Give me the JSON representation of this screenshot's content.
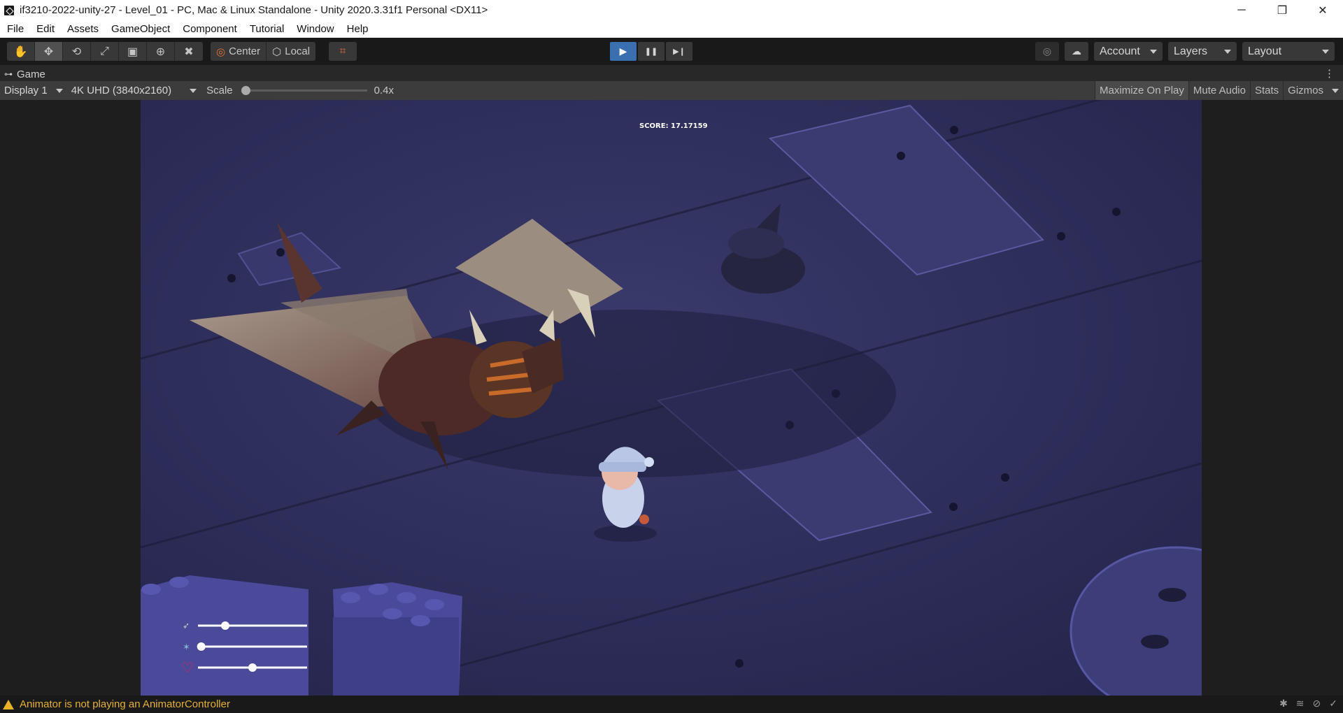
{
  "window": {
    "title": "if3210-2022-unity-27 - Level_01 - PC, Mac & Linux Standalone - Unity 2020.3.31f1 Personal <DX11>",
    "minimize_glyph": "─",
    "restore_glyph": "❐",
    "close_glyph": "✕"
  },
  "menu": [
    "File",
    "Edit",
    "Assets",
    "GameObject",
    "Component",
    "Tutorial",
    "Window",
    "Help"
  ],
  "toolbar": {
    "tools": [
      {
        "name": "hand-tool",
        "glyph": "✋",
        "active": false
      },
      {
        "name": "move-tool",
        "glyph": "✥",
        "active": true
      },
      {
        "name": "rotate-tool",
        "glyph": "⟲",
        "active": false
      },
      {
        "name": "scale-tool",
        "glyph": "⤢",
        "active": false
      },
      {
        "name": "rect-tool",
        "glyph": "▣",
        "active": false
      },
      {
        "name": "transform-tool",
        "glyph": "⊕",
        "active": false
      },
      {
        "name": "custom-tool",
        "glyph": "✖",
        "active": false
      }
    ],
    "pivot_label": "Center",
    "space_label": "Local",
    "grid_glyph": "⌗",
    "play_glyph": "▶",
    "pause_glyph": "❚❚",
    "step_glyph": "▶❙",
    "collab_glyph": "◎",
    "cloud_glyph": "☁",
    "account_label": "Account",
    "layers_label": "Layers",
    "layout_label": "Layout"
  },
  "game_tab": {
    "label": "Game",
    "menu_glyph": "⋮"
  },
  "game_bar": {
    "display": "Display 1",
    "resolution": "4K UHD (3840x2160)",
    "scale_label": "Scale",
    "scale_value": "0.4x",
    "scale_fraction": 0.0,
    "maximize_on_play": "Maximize On Play",
    "mute_audio": "Mute Audio",
    "stats": "Stats",
    "gizmos": "Gizmos"
  },
  "hud": {
    "score": "SCORE: 17.17159",
    "sliders": [
      {
        "name": "speed-slider",
        "value": 0.25
      },
      {
        "name": "power-slider",
        "value": 0.03
      },
      {
        "name": "health-slider",
        "value": 0.5
      }
    ]
  },
  "status": {
    "message": "Animator is not playing an AnimatorController"
  },
  "colors": {
    "accent": "#3a6fb0",
    "warning": "#e6b325",
    "floor": "#2c2c52",
    "heart": "#e0245e"
  }
}
